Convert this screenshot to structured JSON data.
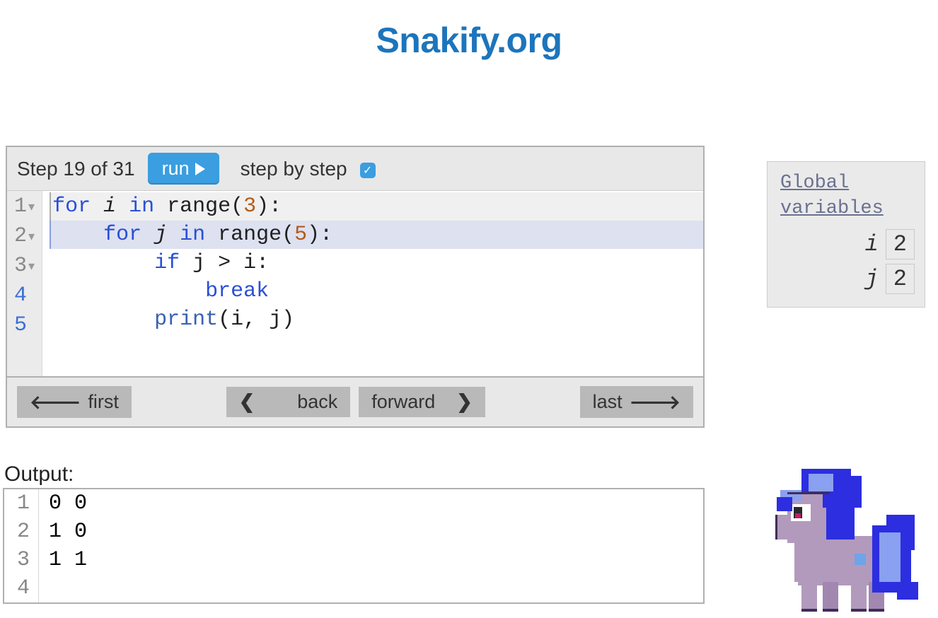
{
  "site": {
    "title": "Snakify.org"
  },
  "toolbar": {
    "step_text": "Step 19 of 31",
    "run_label": "run",
    "sbs_label": "step by step",
    "sbs_checked": true
  },
  "code": {
    "gutter": [
      {
        "num": "1",
        "foldable": true,
        "active": false
      },
      {
        "num": "2",
        "foldable": true,
        "active": false
      },
      {
        "num": "3",
        "foldable": true,
        "active": false
      },
      {
        "num": "4",
        "foldable": false,
        "active": true
      },
      {
        "num": "5",
        "foldable": false,
        "active": true
      }
    ],
    "highlighted_line": 2,
    "line1": {
      "t1": "for",
      "t2": " i ",
      "t3": "in",
      "t4": " range(",
      "n": "3",
      "t5": "):"
    },
    "line2": {
      "indent": "    ",
      "t1": "for",
      "t2": " j ",
      "t3": "in",
      "t4": " range(",
      "n": "5",
      "t5": "):"
    },
    "line3": {
      "indent": "        ",
      "t1": "if",
      "t2": " j > i:"
    },
    "line4": {
      "indent": "            ",
      "t1": "break"
    },
    "line5": {
      "indent": "        ",
      "fn": "print",
      "rest": "(i, j)"
    }
  },
  "nav": {
    "first": "first",
    "back": "back",
    "forward": "forward",
    "last": "last"
  },
  "output": {
    "label": "Output:",
    "lines": [
      "0 0",
      "1 0",
      "1 1",
      ""
    ]
  },
  "globals": {
    "title": "Global variables",
    "vars": [
      {
        "name": "i",
        "value": "2"
      },
      {
        "name": "j",
        "value": "2"
      }
    ]
  }
}
